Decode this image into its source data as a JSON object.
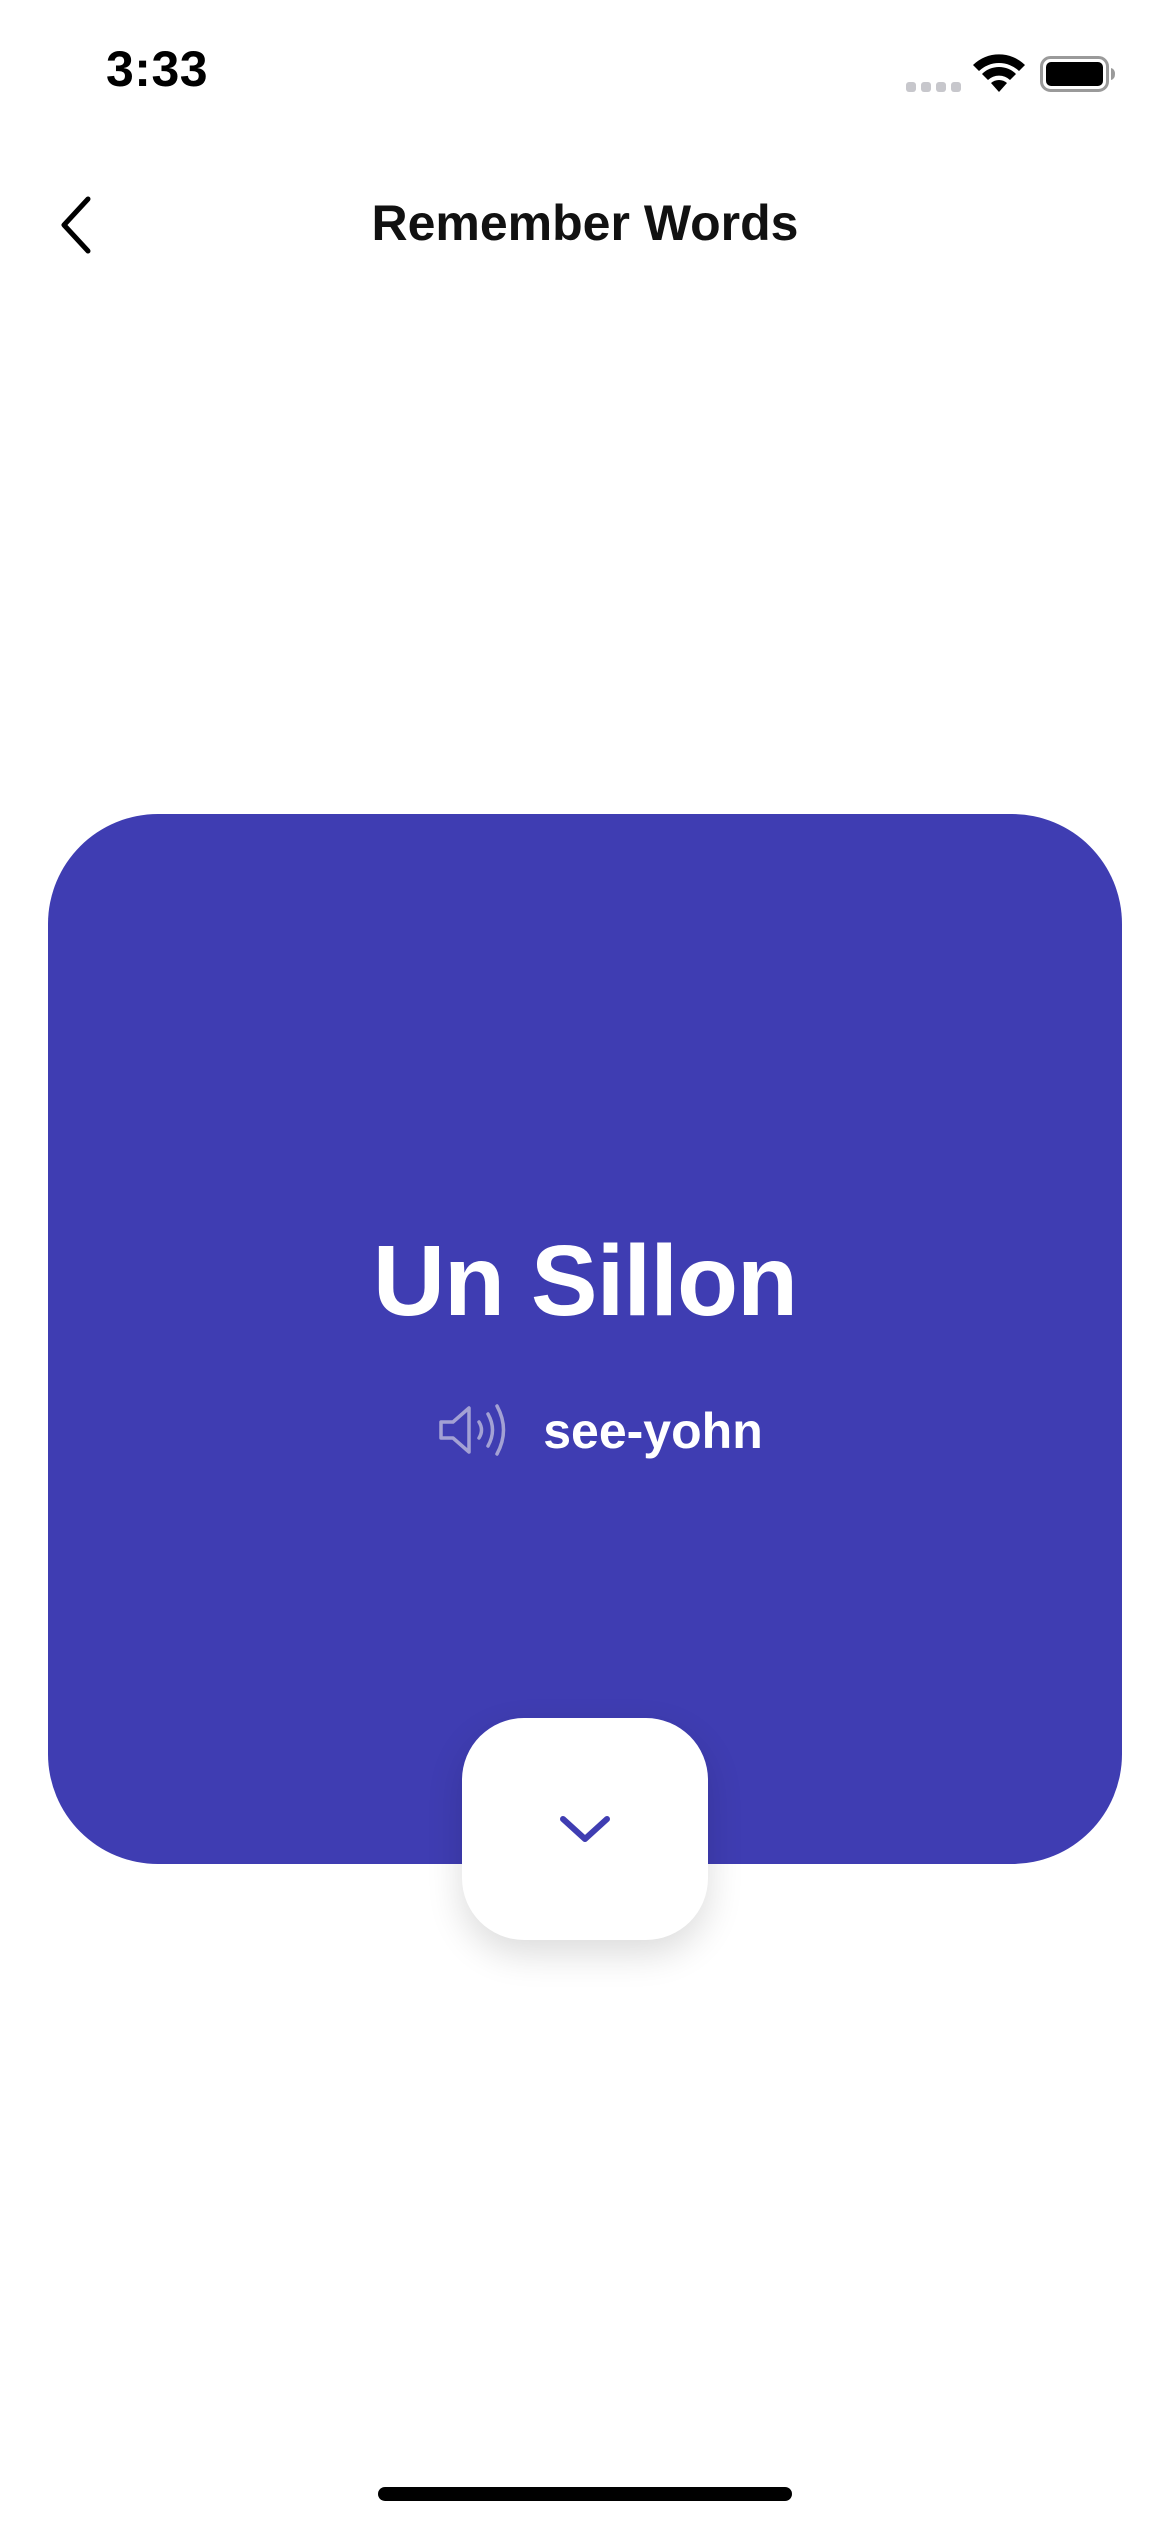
{
  "status_bar": {
    "time": "3:33"
  },
  "nav": {
    "title": "Remember Words",
    "back_icon": "chevron-left-icon"
  },
  "card": {
    "word": "Un Sillon",
    "pronunciation": "see-yohn",
    "speaker_icon": "speaker-icon",
    "background_color": "#3f3db2"
  },
  "flip_button": {
    "icon": "chevron-down-icon",
    "icon_color": "#3f3db2"
  }
}
